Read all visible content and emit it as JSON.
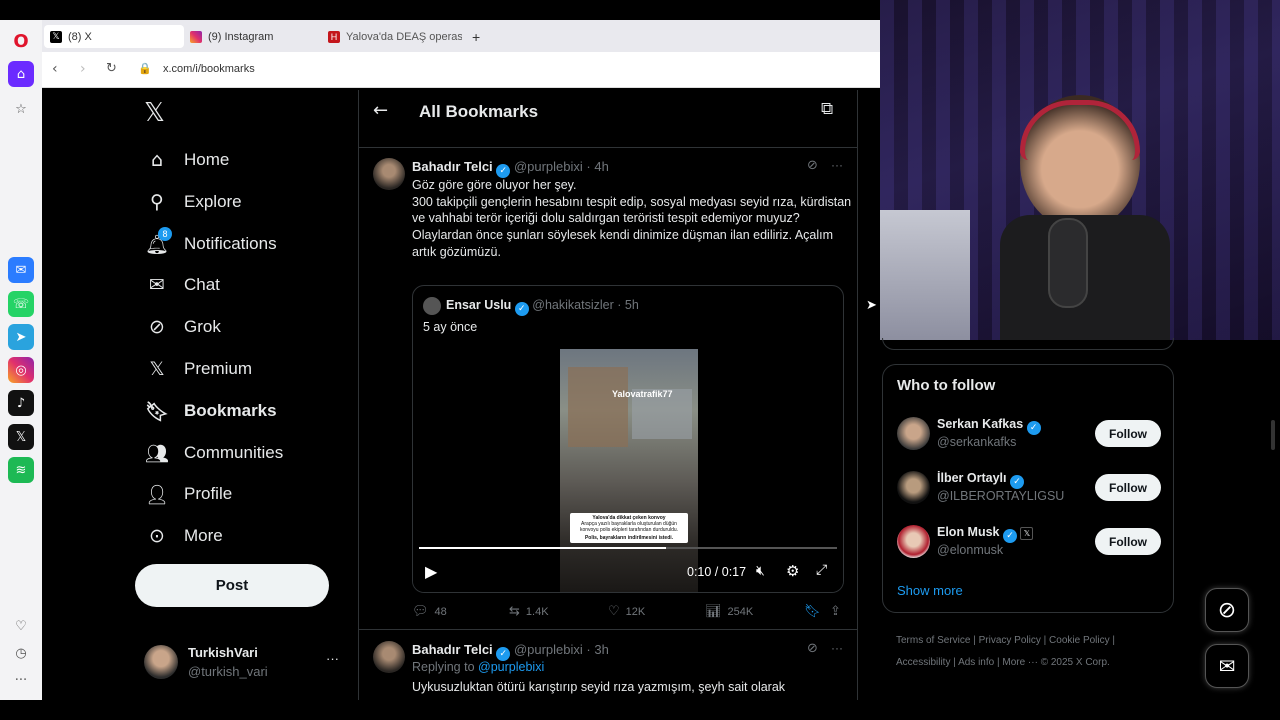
{
  "browser": {
    "tabs": [
      {
        "title": "(8) X",
        "icon": "x-logo-icon",
        "active": true
      },
      {
        "title": "(9) Instagram",
        "icon": "instagram-icon",
        "active": false
      },
      {
        "title": "Yalova'da DEAŞ operasyonu",
        "icon": "haberturk-icon",
        "active": false
      }
    ],
    "new_tab_symbol": "+",
    "url": "x.com/i/bookmarks"
  },
  "sidebar": {
    "notifications_badge": "8",
    "items": [
      {
        "label": "Home",
        "icon": "home-icon"
      },
      {
        "label": "Explore",
        "icon": "search-icon"
      },
      {
        "label": "Notifications",
        "icon": "bell-icon"
      },
      {
        "label": "Chat",
        "icon": "mail-icon"
      },
      {
        "label": "Grok",
        "icon": "grok-icon"
      },
      {
        "label": "Premium",
        "icon": "x-logo-icon"
      },
      {
        "label": "Bookmarks",
        "icon": "bookmark-icon"
      },
      {
        "label": "Communities",
        "icon": "people-icon"
      },
      {
        "label": "Profile",
        "icon": "person-icon"
      },
      {
        "label": "More",
        "icon": "more-circle-icon"
      }
    ],
    "post_button": "Post",
    "account": {
      "name": "TurkishVari",
      "handle": "@turkish_vari",
      "more": "···"
    }
  },
  "header": {
    "title": "All Bookmarks"
  },
  "tweet1": {
    "author": "Bahadır Telci",
    "handle": "@purplebixi",
    "time": "· 4h",
    "more": "···",
    "text": "Göz göre göre oluyor her şey.\n300 takipçili gençlerin hesabını tespit edip, sosyal medyası seyid rıza, kürdistan ve vahhabi terör içeriği dolu saldırgan teröristi tespit edemiyor muyuz?\nOlaylardan önce şunları söylesek kendi dinimize düşman ilan ediliriz. Açalım artık gözümüzü.",
    "quote": {
      "author": "Ensar Uslu",
      "handle": "@hakikatsizler",
      "time": "· 5h",
      "text": "5 ay önce",
      "video_watermark": "Yalovatrafik77",
      "caption1": "Yalova'da dikkat çeken konvoy",
      "caption2": "Arapça yazılı bayraklarla oluşturulan düğün konvoyu polis ekipleri tarafından durduruldu.",
      "caption3": "Polis, bayrakların indirilmesini istedi.",
      "video_time": "0:10 / 0:17",
      "progress": 0.59
    },
    "stats": {
      "replies": "48",
      "reposts": "1.4K",
      "likes": "12K",
      "views": "254K"
    }
  },
  "tweet2": {
    "author": "Bahadır Telci",
    "handle": "@purplebixi",
    "time": "· 3h",
    "more": "···",
    "replying_prefix": "Replying to",
    "replying_to": "@purplebixi",
    "text": "Uykusuzluktan ötürü karıştırıp seyid rıza yazmışım, şeyh sait olarak"
  },
  "who_to_follow": {
    "title": "Who to follow",
    "users": [
      {
        "name": "Serkan Kafkas",
        "handle": "@serkankafks",
        "button": "Follow",
        "affiliate": ""
      },
      {
        "name": "İlber Ortaylı",
        "handle": "@ILBERORTAYLIGSU",
        "button": "Follow",
        "affiliate": ""
      },
      {
        "name": "Elon Musk",
        "handle": "@elonmusk",
        "button": "Follow",
        "affiliate": "𝕏"
      }
    ],
    "show_more": "Show more"
  },
  "footer": {
    "links": [
      "Terms of Service",
      "Privacy Policy",
      "Cookie Policy",
      "Accessibility",
      "Ads info",
      "More ···"
    ],
    "copyright": "© 2025 X Corp."
  },
  "colors": {
    "accent": "#1d9bf0",
    "background": "#000000",
    "border": "#2f3336",
    "opera_red": "#e0142c",
    "opera_active": "#6b2bff"
  }
}
